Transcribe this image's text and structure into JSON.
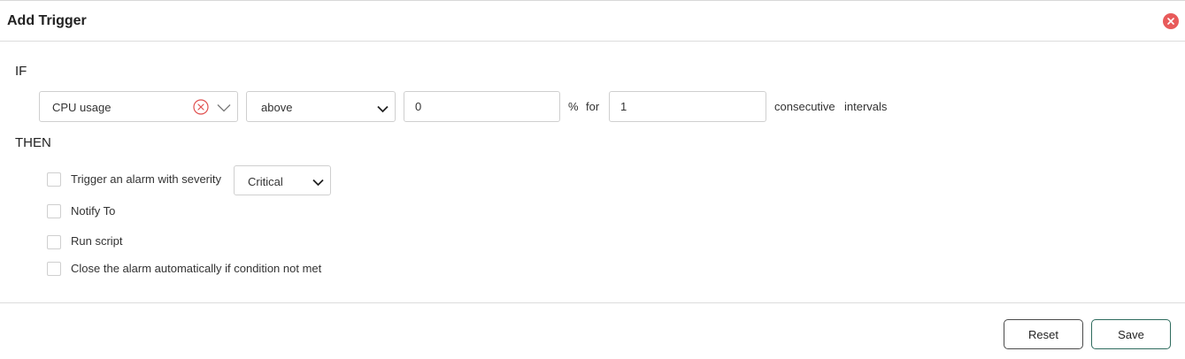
{
  "dialog": {
    "title": "Add Trigger"
  },
  "condition": {
    "if_label": "IF",
    "metric": "CPU usage",
    "operator": "above",
    "threshold": "0",
    "unit": "%",
    "for_label": "for",
    "intervals": "1",
    "consecutive_label": "consecutive",
    "intervals_label": "intervals"
  },
  "actions": {
    "then_label": "THEN",
    "items": [
      {
        "label": "Trigger an alarm with severity",
        "checked": false
      },
      {
        "label": "Notify To",
        "checked": false
      },
      {
        "label": "Run script",
        "checked": false
      },
      {
        "label": "Close the alarm automatically if condition not met",
        "checked": false
      }
    ],
    "severity": "Critical"
  },
  "footer": {
    "reset_label": "Reset",
    "save_label": "Save"
  },
  "colors": {
    "close_button": "#e85a5a",
    "save_border": "#2e6b5e",
    "clear_icon": "#e0504f"
  },
  "icons": {
    "close": "close-icon",
    "clear": "clear-circle-icon",
    "dropdown": "chevron-down-icon"
  }
}
